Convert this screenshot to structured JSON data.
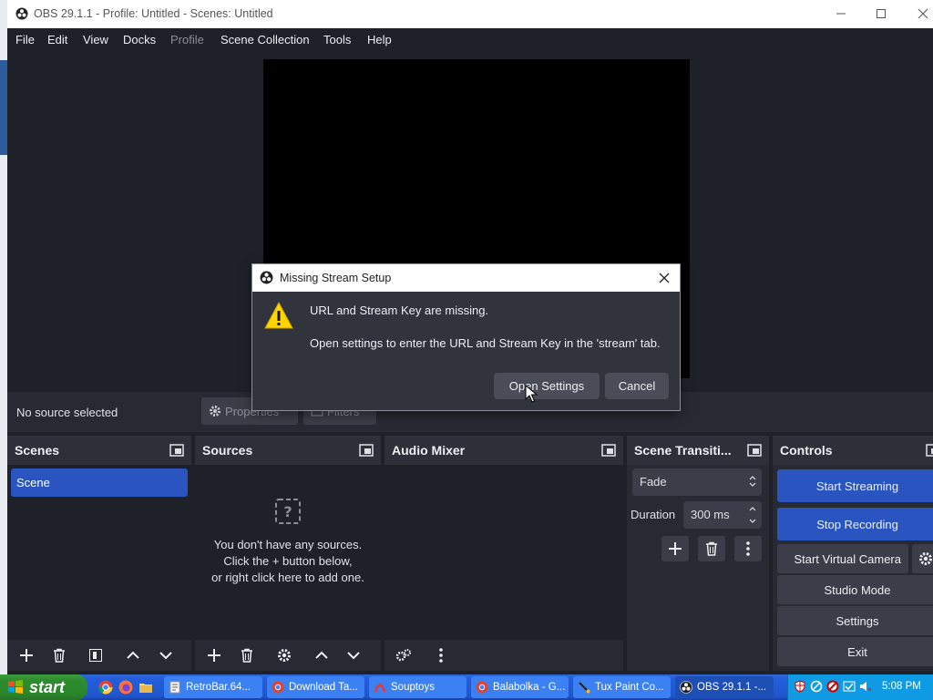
{
  "window": {
    "title": "OBS 29.1.1 - Profile: Untitled - Scenes: Untitled"
  },
  "menu": [
    "File",
    "Edit",
    "View",
    "Docks",
    "Profile",
    "Scene Collection",
    "Tools",
    "Help"
  ],
  "source_toolbar": {
    "status": "No source selected",
    "properties_label": "Properties",
    "filters_label": "Filters"
  },
  "docks": {
    "scenes": {
      "title": "Scenes",
      "items": [
        "Scene"
      ]
    },
    "sources": {
      "title": "Sources",
      "empty_lines": [
        "You don't have any sources.",
        "Click the + button below,",
        "or right click here to add one."
      ]
    },
    "audio_mixer": {
      "title": "Audio Mixer"
    },
    "transitions": {
      "title": "Scene Transiti...",
      "transition": "Fade",
      "duration_label": "Duration",
      "duration_value": "300 ms"
    },
    "controls": {
      "title": "Controls",
      "start_streaming": "Start Streaming",
      "stop_recording": "Stop Recording",
      "virtual_camera": "Start Virtual Camera",
      "studio_mode": "Studio Mode",
      "settings": "Settings",
      "exit": "Exit"
    }
  },
  "dialog": {
    "title": "Missing Stream Setup",
    "message": "URL and Stream Key are missing.",
    "detail": "Open settings to enter the URL and Stream Key in the 'stream' tab.",
    "open_settings": "Open Settings",
    "cancel": "Cancel"
  },
  "taskbar": {
    "start": "start",
    "tasks": [
      "RetroBar.64...",
      "Download Ta...",
      "Souptoys",
      "Balabolka - G...",
      "Tux Paint Co...",
      "OBS 29.1.1 -..."
    ],
    "time": "5:08 PM"
  },
  "colors": {
    "accent": "#2a55c1",
    "panel": "#272a33",
    "background": "#1f2129"
  }
}
